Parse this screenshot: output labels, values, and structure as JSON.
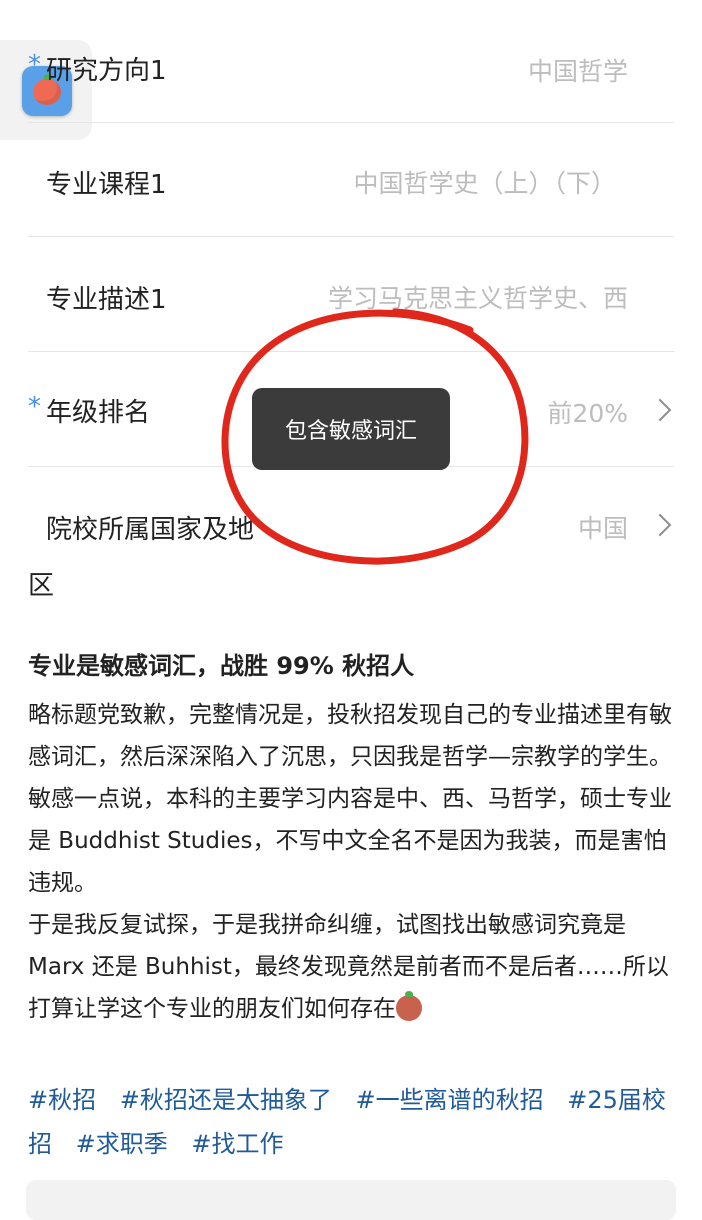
{
  "form": {
    "research_direction": {
      "label": "研究方向1",
      "value": "中国哲学",
      "required": "*"
    },
    "course": {
      "label": "专业课程1",
      "value": "中国哲学史（上）（下）"
    },
    "description": {
      "label": "专业描述1",
      "value": "学习马克思主义哲学史、西"
    },
    "rank": {
      "label": "年级排名",
      "value": "前20%",
      "required": "*"
    },
    "country": {
      "label_line1": "院校所属国家及地",
      "label_line2": "区",
      "value": "中国"
    }
  },
  "toast": {
    "text": "包含敏感词汇"
  },
  "post": {
    "title": "专业是敏感词汇，战胜 99% 秋招人",
    "paragraphs": [
      "略标题党致歉，完整情况是，投秋招发现自己的专业描述里有敏感词汇，然后深深陷入了沉思，只因我是哲学—宗教学的学生。",
      "敏感一点说，本科的主要学习内容是中、西、马哲学，硕士专业是 Buddhist Studies，不写中文全名不是因为我装，而是害怕违规。",
      "于是我反复试探，于是我拼命纠缠，试图找出敏感词究竟是 Marx 还是 Buhhist，最终发现竟然是前者而不是后者……所以打算让学这个专业的朋友们如何存在"
    ],
    "emoji": "tomato-sweat-emoji",
    "tags": [
      "#秋招",
      "#秋招还是太抽象了",
      "#一些离谱的秋招",
      "#25届校招",
      "#求职季",
      "#找工作"
    ]
  },
  "colors": {
    "accent": "#4a90e2",
    "toast_bg": "#3b3b3b",
    "circle": "#e0271b",
    "tag": "#1f5a99"
  }
}
